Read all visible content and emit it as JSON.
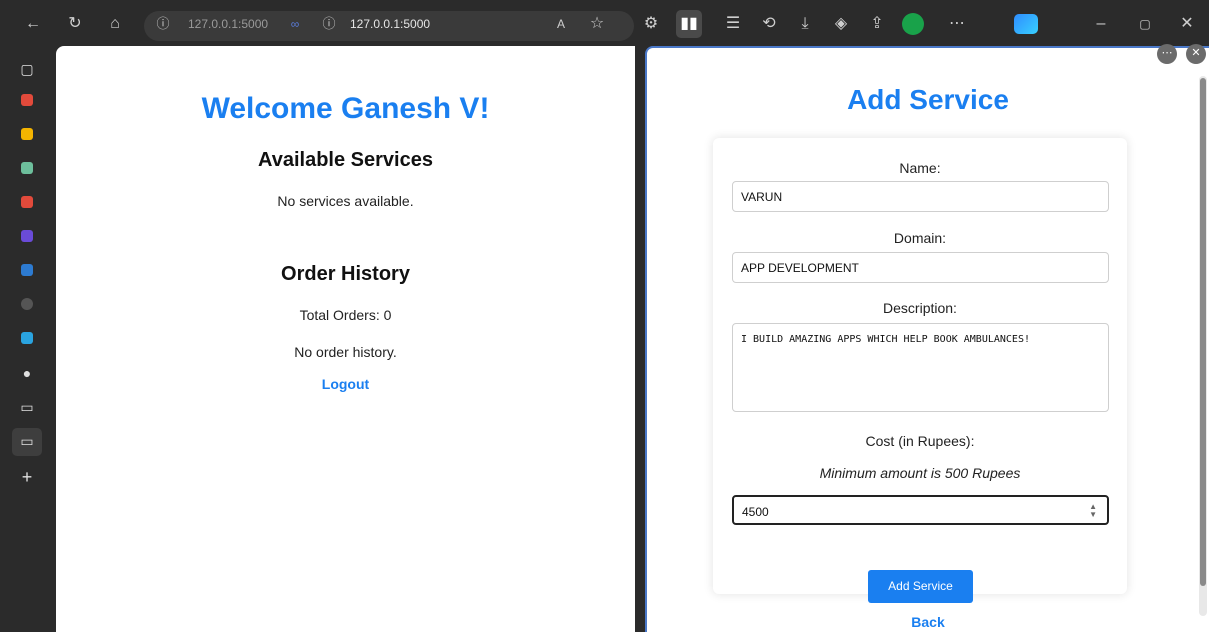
{
  "browser": {
    "url_left": "127.0.0.1:5000",
    "url_right": "127.0.0.1:5000",
    "info_icon": "info-icon",
    "split_icon": "split-link-icon"
  },
  "left_page": {
    "welcome": "Welcome Ganesh V!",
    "services_heading": "Available Services",
    "no_services": "No services available.",
    "order_heading": "Order History",
    "total_orders": "Total Orders: 0",
    "no_history": "No order history.",
    "logout": "Logout"
  },
  "right_page": {
    "title": "Add Service",
    "name_label": "Name:",
    "name_value": "VARUN",
    "domain_label": "Domain:",
    "domain_value": "APP DEVELOPMENT",
    "description_label": "Description:",
    "description_value": "I BUILD AMAZING APPS WHICH HELP BOOK AMBULANCES!",
    "cost_label": "Cost (in Rupees):",
    "min_note": "Minimum amount is 500 Rupees",
    "cost_value": "4500",
    "submit": "Add Service",
    "back": "Back"
  },
  "colors": {
    "accent": "#1a7ff0",
    "chrome": "#2b2b2b"
  }
}
